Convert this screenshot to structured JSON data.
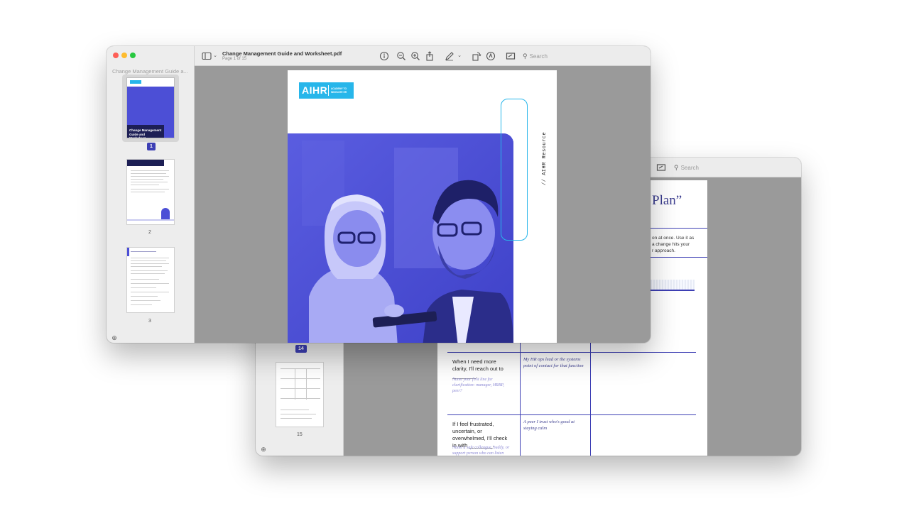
{
  "front_window": {
    "sidebar_title": "Change Management Guide a...",
    "document_title": "Change Management Guide and Worksheet.pdf",
    "page_indicator": "Page 1 of 15",
    "search_placeholder": "Search",
    "thumbnails": [
      {
        "page": "1",
        "selected": true,
        "cover_text": "Change Management Guide and Worksheet"
      },
      {
        "page": "2",
        "selected": false
      },
      {
        "page": "3",
        "selected": false
      }
    ],
    "cover": {
      "logo_text": "AIHR",
      "logo_tagline": "ACADEMY TO INNOVATE HR",
      "side_label": "// AIHR Resource"
    }
  },
  "back_window": {
    "search_placeholder": "Search",
    "thumbnails": [
      {
        "page": "14",
        "selected": true
      },
      {
        "page": "15",
        "selected": false
      }
    ],
    "page": {
      "title": "Plan”",
      "intro_lines": [
        "on at once. Use it as",
        "a change hits your",
        "r approach."
      ],
      "rows": [
        {
          "question": "When I need more clarity, I'll reach out to ________.",
          "hint": "Name your  first line for clarification: manager, HRBP, peer?",
          "answer": "My HR ops lead or the systems point of contact for that function"
        },
        {
          "question": "If I feel frustrated, uncertain, or overwhelmed, I'll check in with ________.",
          "hint": "Name a safe colleague, buddy, or support person who can listen",
          "answer": "A peer I trust who's good at staying calm"
        }
      ]
    }
  },
  "colors": {
    "accent_purple": "#3d3fb4",
    "hero_blue": "#4c4fd6",
    "logo_cyan": "#27b6ea",
    "viewer_gray": "#9a9a9a"
  }
}
